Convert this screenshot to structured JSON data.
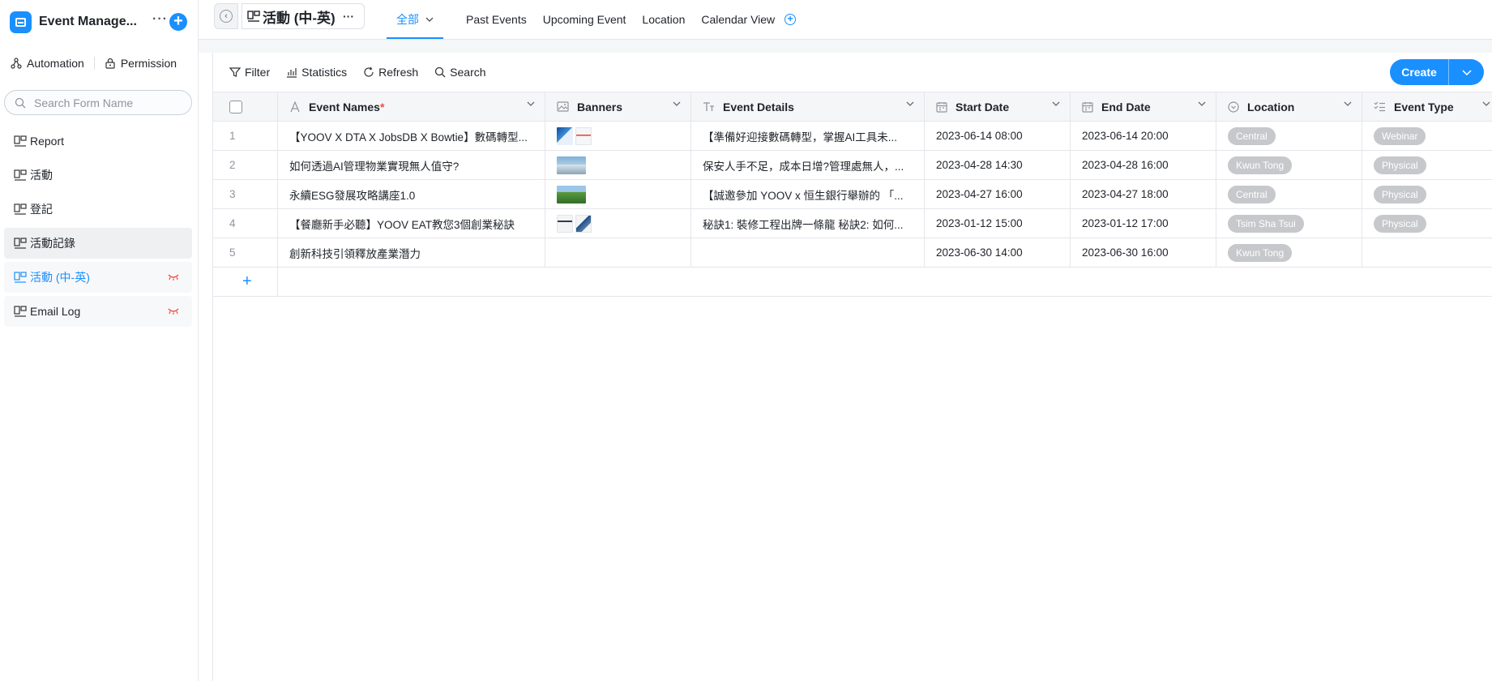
{
  "app": {
    "title": "Event Manage..."
  },
  "sidebar": {
    "tools": {
      "automation": "Automation",
      "permission": "Permission"
    },
    "search_placeholder": "Search Form Name",
    "items": [
      {
        "label": "Report"
      },
      {
        "label": "活動"
      },
      {
        "label": "登記"
      },
      {
        "label": "活動記錄"
      },
      {
        "label": "活動 (中-英)"
      },
      {
        "label": "Email Log"
      }
    ]
  },
  "topbar": {
    "form_title": "活動 (中-英)",
    "tabs": [
      {
        "label": "全部"
      },
      {
        "label": "Past Events"
      },
      {
        "label": "Upcoming Event"
      },
      {
        "label": "Location"
      },
      {
        "label": "Calendar View"
      }
    ]
  },
  "toolbar": {
    "filter": "Filter",
    "statistics": "Statistics",
    "refresh": "Refresh",
    "search": "Search",
    "create": "Create"
  },
  "table": {
    "columns": {
      "event_names": "Event Names",
      "banners": "Banners",
      "event_details": "Event Details",
      "start_date": "Start Date",
      "end_date": "End Date",
      "location": "Location",
      "event_type": "Event Type"
    },
    "rows": [
      {
        "num": "1",
        "name": "【YOOV X DTA X JobsDB X Bowtie】數碼轉型...",
        "details": "【準備好迎接數碼轉型，掌握AI工具未...",
        "start": "2023-06-14 08:00",
        "end": "2023-06-14 20:00",
        "location": "Central",
        "type": "Webinar"
      },
      {
        "num": "2",
        "name": "如何透過AI管理物業實現無人值守?",
        "details": "保安人手不足，成本日增?管理處無人，...",
        "start": "2023-04-28 14:30",
        "end": "2023-04-28 16:00",
        "location": "Kwun Tong",
        "type": "Physical"
      },
      {
        "num": "3",
        "name": "永續ESG發展攻略講座1.0",
        "details": "【誠邀參加 YOOV x 恒生銀行舉辦的 「...",
        "start": "2023-04-27 16:00",
        "end": "2023-04-27 18:00",
        "location": "Central",
        "type": "Physical"
      },
      {
        "num": "4",
        "name": "【餐廳新手必聽】YOOV EAT教您3個創業秘訣",
        "details": "秘訣1: 裝修工程出牌一條龍 秘訣2: 如何...",
        "start": "2023-01-12 15:00",
        "end": "2023-01-12 17:00",
        "location": "Tsim Sha Tsui",
        "type": "Physical"
      },
      {
        "num": "5",
        "name": "創新科技引領釋放產業潛力",
        "details": "",
        "start": "2023-06-30 14:00",
        "end": "2023-06-30 16:00",
        "location": "Kwun Tong",
        "type": ""
      }
    ],
    "add_row": "+"
  },
  "colors": {
    "accent": "#1a90ff",
    "tag_bg": "#c7c8cb",
    "sidebar_hover": "#eff0f1"
  }
}
